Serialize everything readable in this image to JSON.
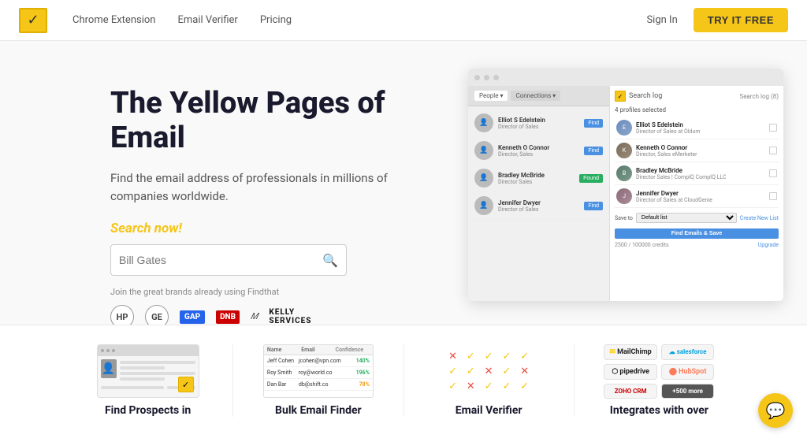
{
  "nav": {
    "links": [
      "Chrome Extension",
      "Email Verifier",
      "Pricing"
    ],
    "sign_in": "Sign In",
    "try_free": "TRY IT FREE"
  },
  "hero": {
    "title": "The Yellow Pages of Email",
    "subtitle": "Find the email address of professionals in millions of companies worldwide.",
    "search_label": "Search now!",
    "search_placeholder": "Bill Gates",
    "brands_label": "Join the great brands already using Findthat",
    "brands": [
      "HP",
      "GE",
      "GAP",
      "DNB",
      "Marriott",
      "KELLY SERVICES"
    ]
  },
  "extension": {
    "search_label": "Search log (8)",
    "selected_label": "4 profiles selected",
    "persons": [
      {
        "name": "Elliot S Edelstein",
        "role": "Director of Sales at Oldum"
      },
      {
        "name": "Kenneth O Connor",
        "role": "Director, Sales eMerketer"
      },
      {
        "name": "Bradley McBride",
        "role": "Director Sales | CompIQ CompIQ LLC"
      },
      {
        "name": "Jennifer Dwyer",
        "role": "Director of Sales at CloudGenie"
      }
    ],
    "save_to_label": "Save to",
    "save_select": "Default list",
    "create_new_list": "Create New List",
    "find_save_btn": "Find Emails & Save",
    "credits": "2500 / 100000 credits",
    "upgrade_label": "Upgrade"
  },
  "features": [
    {
      "label": "Find Prospects in",
      "type": "linkedin"
    },
    {
      "label": "Bulk Email Finder",
      "type": "table",
      "rows": [
        {
          "name": "Jeff Cohen",
          "email": "jcohen@vpn.com",
          "pct": "140%",
          "color": "green"
        },
        {
          "name": "Roy Smith",
          "email": "roy@world.co",
          "pct": "196%",
          "color": "green"
        },
        {
          "name": "Dan Bar",
          "email": "db@shift.co",
          "pct": "78%",
          "color": "orange"
        }
      ]
    },
    {
      "label": "Email Verifier",
      "type": "checks"
    },
    {
      "label": "Integrates with over",
      "type": "integrations",
      "badges": [
        "MailChimp",
        "Salesforce",
        "Pipedrive",
        "HubSpot",
        "ZOHO",
        "+500 more"
      ]
    }
  ]
}
